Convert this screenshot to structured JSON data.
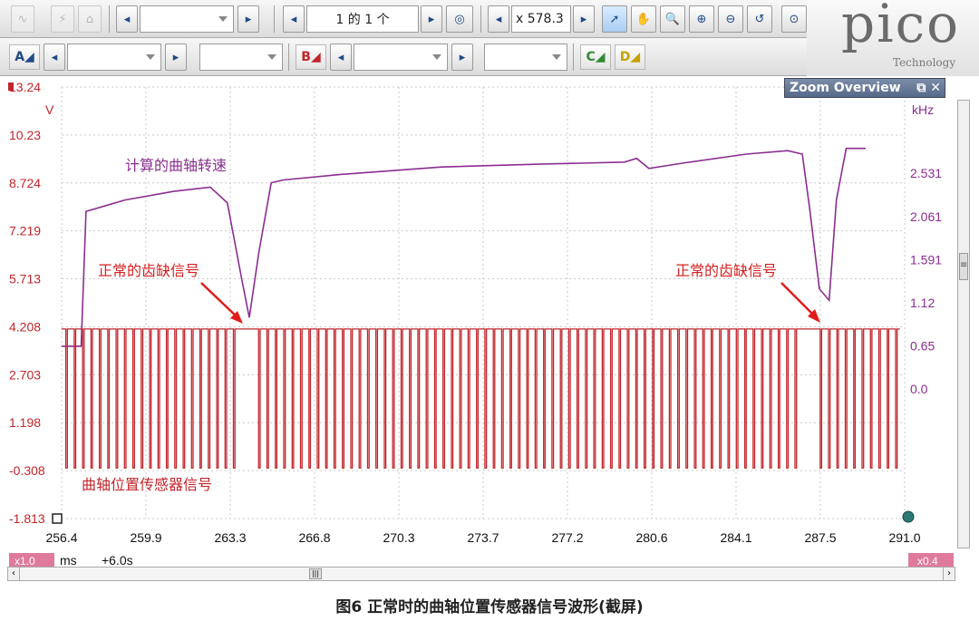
{
  "toolbar1": {
    "zoom_field": "",
    "buffer_label": "1 的 1 个",
    "zoom_factor": "x 578.3"
  },
  "toolbar2": {
    "channel_a": "A",
    "channel_b": "B",
    "channel_c": "C",
    "channel_d": "D"
  },
  "brand": {
    "logo": "pico",
    "subtitle": "Technology"
  },
  "zoom_overview": {
    "title": "Zoom Overview"
  },
  "chart_data": {
    "type": "line",
    "left_axis": {
      "unit": "V",
      "ticks": [
        "13.24",
        "10.23",
        "8.724",
        "7.219",
        "5.713",
        "4.208",
        "2.703",
        "1.198",
        "-0.308",
        "-1.813"
      ],
      "ylim": [
        -1.813,
        13.24
      ]
    },
    "right_axis": {
      "unit": "kHz",
      "ticks": [
        "2.531",
        "2.061",
        "1.591",
        "1.12",
        "0.65",
        "0.0"
      ]
    },
    "x_axis": {
      "unit": "ms",
      "ticks": [
        "256.4",
        "259.9",
        "263.3",
        "266.8",
        "270.3",
        "273.7",
        "277.2",
        "280.6",
        "284.1",
        "287.5",
        "291.0"
      ],
      "xlim": [
        256.4,
        291.0
      ],
      "offset": "+6.0s",
      "left_zoom": "x1.0",
      "right_zoom": "x0.4"
    },
    "annotations": [
      {
        "text": "计算的曲轴转速",
        "color": "#8b2d90"
      },
      {
        "text": "正常的齿缺信号",
        "color": "#d62020"
      },
      {
        "text": "正常的齿缺信号",
        "color": "#d62020"
      },
      {
        "text": "曲轴位置传感器信号",
        "color": "#c0252b"
      }
    ],
    "series": [
      {
        "color": "#8b2d90",
        "x": [
          256.4,
          257.2,
          257.4,
          259.0,
          261.0,
          262.5,
          263.2,
          263.8,
          264.1,
          264.5,
          265.0,
          265.5,
          268.0,
          272.0,
          276.0,
          279.5,
          280.0,
          280.5,
          282.0,
          284.5,
          286.2,
          286.8,
          287.1,
          287.5,
          287.9,
          288.2,
          288.6,
          289.4
        ],
        "y": [
          4.2,
          4.2,
          8.9,
          9.3,
          9.6,
          9.75,
          9.2,
          6.5,
          5.2,
          7.5,
          9.9,
          10.0,
          10.2,
          10.45,
          10.55,
          10.62,
          10.75,
          10.4,
          10.6,
          10.9,
          11.02,
          10.9,
          9.0,
          6.2,
          5.8,
          9.3,
          11.1,
          11.1
        ]
      },
      {
        "color": "#c0252b",
        "high": 4.8,
        "low": -0.05,
        "tooth_start": 256.4,
        "tooth_end": 290.8,
        "gaps": [
          [
            263.6,
            264.4
          ],
          [
            286.8,
            287.4
          ]
        ]
      }
    ]
  },
  "caption": "图6   正常时的曲轴位置传感器信号波形(截屏)"
}
